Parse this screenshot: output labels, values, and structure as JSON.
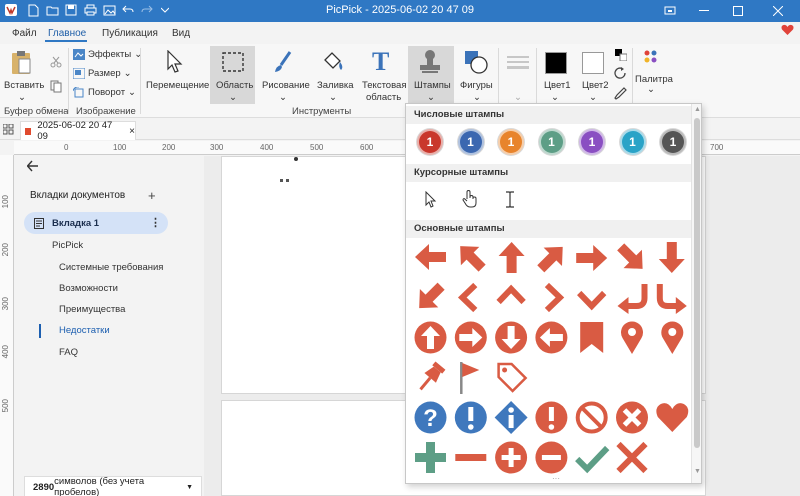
{
  "app": {
    "title": "PicPick - 2025-06-02 20 47 09"
  },
  "menu": {
    "items": [
      "Файл",
      "Главное",
      "Публикация",
      "Вид"
    ],
    "active": "Главное"
  },
  "ribbon": {
    "clipboard": {
      "paste_label": "Вставить",
      "group_label": "Буфер обмена"
    },
    "image": {
      "effects_label": "Эффекты",
      "resize_label": "Размер",
      "rotate_label": "Поворот",
      "group_label": "Изображение"
    },
    "tools": {
      "move_label": "Перемещение",
      "area_label": "Область",
      "draw_label": "Рисование",
      "fill_label": "Заливка",
      "text_label_1": "Текстовая",
      "text_label_2": "область",
      "stamps_label": "Штампы",
      "shapes_label": "Фигуры",
      "group_label": "Инструменты"
    },
    "colors": {
      "color1_label": "Цвет1",
      "color2_label": "Цвет2",
      "palette_label": "Палитра",
      "color1": "#000000",
      "color2": "#ffffff"
    }
  },
  "tab": {
    "name": "2025-06-02 20 47 09"
  },
  "ruler": {
    "h": [
      "0",
      "100",
      "200",
      "300",
      "400",
      "500",
      "600",
      "700"
    ],
    "v": [
      "100",
      "200",
      "300",
      "400",
      "500"
    ]
  },
  "left_panel": {
    "title": "Вкладки документов",
    "tab_label": "Вкладка 1",
    "root": "PicPick",
    "items": [
      "Системные требования",
      "Возможности",
      "Преимущества",
      "Недостатки",
      "FAQ"
    ],
    "active_item": "Недостатки",
    "count_value": "2890",
    "count_text": " символов (без учета пробелов)"
  },
  "dropdown": {
    "numbered_title": "Числовые штампы",
    "cursor_title": "Курсорные штампы",
    "basic_title": "Основные штампы",
    "numbered": [
      {
        "label": "1",
        "color": "#c9372c"
      },
      {
        "label": "1",
        "color": "#3b67b0"
      },
      {
        "label": "1",
        "color": "#e8842c"
      },
      {
        "label": "1",
        "color": "#5d9e86"
      },
      {
        "label": "1",
        "color": "#8a4fc2"
      },
      {
        "label": "1",
        "color": "#2aa3c7"
      },
      {
        "label": "1",
        "color": "#555555"
      }
    ],
    "cursors": [
      "arrow-cursor-icon",
      "hand-cursor-icon",
      "text-cursor-icon"
    ],
    "stamp_colors": {
      "red": "#d95b43",
      "blue": "#3f78bd",
      "green": "#5d9e86"
    }
  }
}
